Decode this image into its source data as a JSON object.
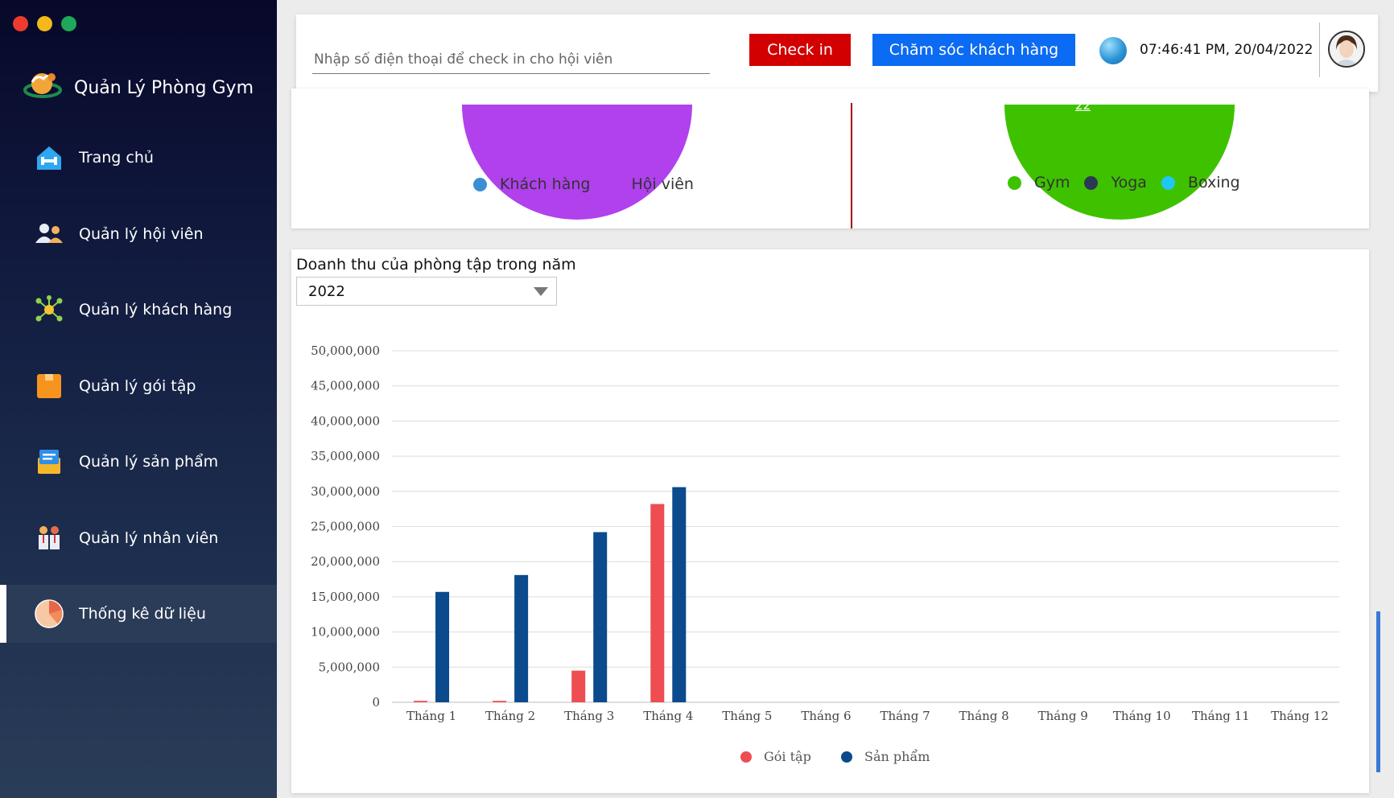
{
  "window": {
    "traffic_colors": [
      "#ee3b30",
      "#f3b81a",
      "#1fa85a"
    ]
  },
  "sidebar": {
    "brand": "Quản Lý Phòng Gym",
    "items": [
      {
        "label": "Trang chủ",
        "icon": "home-gym-icon"
      },
      {
        "label": "Quản lý hội viên",
        "icon": "members-icon"
      },
      {
        "label": "Quản lý khách hàng",
        "icon": "network-icon"
      },
      {
        "label": "Quản lý gói tập",
        "icon": "package-icon"
      },
      {
        "label": "Quản lý sản phẩm",
        "icon": "product-box-icon"
      },
      {
        "label": "Quản lý nhân viên",
        "icon": "staff-icon"
      },
      {
        "label": "Thống kê dữ liệu",
        "icon": "pie-chart-icon",
        "active": true
      }
    ]
  },
  "header": {
    "phone_placeholder": "Nhập số điện thoại để check in cho hội viên",
    "checkin_label": "Check in",
    "care_label": "Chăm sóc khách hàng",
    "datetime": "07:46:41 PM, 20/04/2022"
  },
  "pie_left": {
    "legend": [
      {
        "label": "Khách hàng",
        "color": "#3a8fd4"
      },
      {
        "label": "Hội viên",
        "color": "#b041ed"
      }
    ]
  },
  "pie_right": {
    "label_visible": "22",
    "legend": [
      {
        "label": "Gym",
        "color": "#3ec200"
      },
      {
        "label": "Yoga",
        "color": "#2b3a52"
      },
      {
        "label": "Boxing",
        "color": "#1fc7f2"
      }
    ]
  },
  "revenue": {
    "title": "Doanh thu của phòng tập trong năm",
    "year_selected": "2022"
  },
  "chart_data": {
    "type": "bar",
    "categories": [
      "Tháng 1",
      "Tháng 2",
      "Tháng 3",
      "Tháng 4",
      "Tháng 5",
      "Tháng 6",
      "Tháng 7",
      "Tháng 8",
      "Tháng 9",
      "Tháng 10",
      "Tháng 11",
      "Tháng 12"
    ],
    "series": [
      {
        "name": "Gói tập",
        "color": "#ee4d52",
        "values": [
          200000,
          200000,
          4500000,
          28200000,
          0,
          0,
          0,
          0,
          0,
          0,
          0,
          0
        ]
      },
      {
        "name": "Sản phẩm",
        "color": "#0b4a8c",
        "values": [
          15700000,
          18100000,
          24200000,
          30600000,
          0,
          0,
          0,
          0,
          0,
          0,
          0,
          0
        ]
      }
    ],
    "yticks": [
      "0",
      "5,000,000",
      "10,000,000",
      "15,000,000",
      "20,000,000",
      "25,000,000",
      "30,000,000",
      "35,000,000",
      "40,000,000",
      "45,000,000",
      "50,000,000"
    ],
    "ylim": [
      0,
      50000000
    ],
    "grid": true,
    "legend_position": "bottom"
  }
}
